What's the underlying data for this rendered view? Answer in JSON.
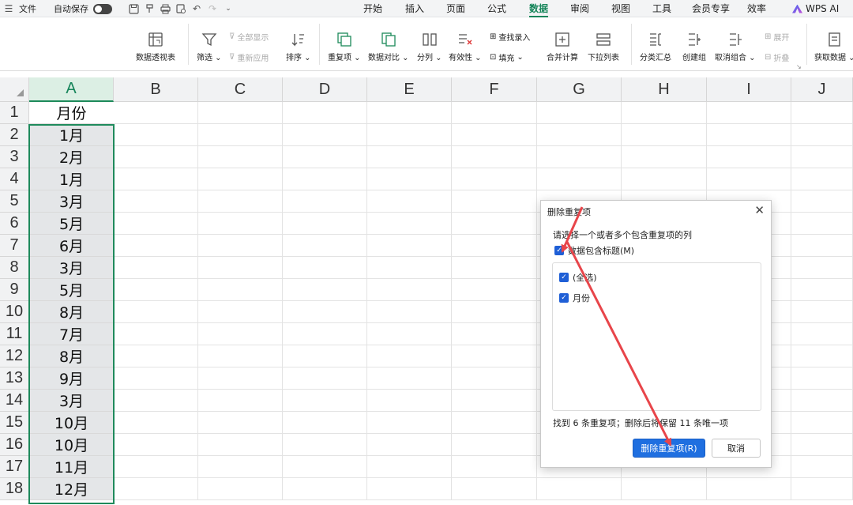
{
  "menubar": {
    "file_label": "文件",
    "autosave_label": "自动保存",
    "tabs": [
      {
        "label": "开始",
        "active": false
      },
      {
        "label": "插入",
        "active": false
      },
      {
        "label": "页面",
        "active": false
      },
      {
        "label": "公式",
        "active": false
      },
      {
        "label": "数据",
        "active": true
      },
      {
        "label": "审阅",
        "active": false
      },
      {
        "label": "视图",
        "active": false
      },
      {
        "label": "工具",
        "active": false
      },
      {
        "label": "会员专享",
        "active": false
      },
      {
        "label": "效率",
        "active": false
      }
    ],
    "wps_ai_label": "WPS AI"
  },
  "ribbon": {
    "pivot_table": "数据透视表",
    "filter": "筛选",
    "show_all": "全部显示",
    "reapply": "重新应用",
    "sort": "排序",
    "duplicates": "重复项",
    "compare": "数据对比",
    "split": "分列",
    "validity": "有效性",
    "lookup_entry": "查找录入",
    "fill": "填充",
    "consolidate": "合并计算",
    "dropdown_list": "下拉列表",
    "subtotal": "分类汇总",
    "group": "创建组",
    "ungroup": "取消组合",
    "expand": "展开",
    "collapse": "折叠",
    "get_data": "获取数据"
  },
  "sheet": {
    "columns": [
      "A",
      "B",
      "C",
      "D",
      "E",
      "F",
      "G",
      "H",
      "I",
      "J"
    ],
    "rows": [
      "1",
      "2",
      "3",
      "4",
      "5",
      "6",
      "7",
      "8",
      "9",
      "10",
      "11",
      "12",
      "13",
      "14",
      "15",
      "16",
      "17",
      "18"
    ],
    "col_a_values": [
      "月份",
      "1月",
      "2月",
      "1月",
      "3月",
      "5月",
      "6月",
      "3月",
      "5月",
      "8月",
      "7月",
      "8月",
      "9月",
      "3月",
      "10月",
      "10月",
      "11月",
      "12月"
    ]
  },
  "dialog": {
    "title": "删除重复项",
    "prompt": "请选择一个或者多个包含重复项的列",
    "header_checkbox": "数据包含标题(M)",
    "options": [
      "(全选)",
      "月份"
    ],
    "status": "找到 6 条重复项；删除后将保留 11 条唯一项",
    "primary_button": "删除重复项(R)",
    "cancel_button": "取消"
  },
  "colors": {
    "accent_green": "#16855a",
    "primary_blue": "#1f6fe0",
    "arrow_red": "#e8454a"
  }
}
